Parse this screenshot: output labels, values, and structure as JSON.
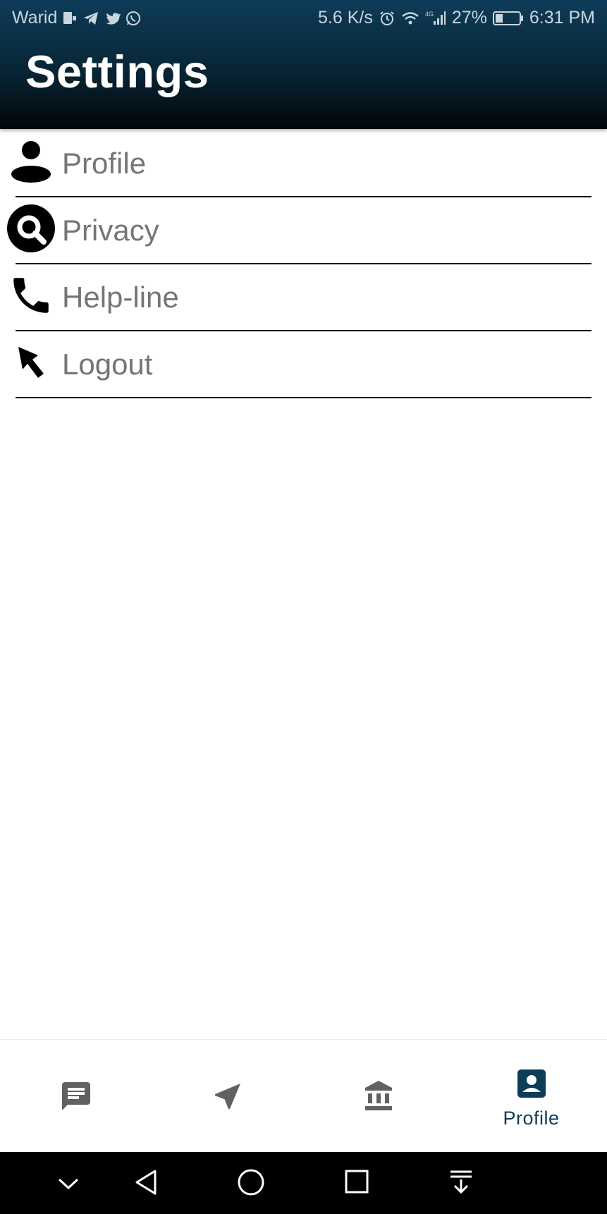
{
  "status_bar": {
    "carrier": "Warid",
    "speed": "5.6 K/s",
    "network": "4G",
    "battery": "27%",
    "time": "6:31 PM"
  },
  "header": {
    "title": "Settings"
  },
  "menu": {
    "items": [
      {
        "label": "Profile",
        "icon": "person-icon"
      },
      {
        "label": "Privacy",
        "icon": "privacy-search-icon"
      },
      {
        "label": "Help-line",
        "icon": "phone-icon"
      },
      {
        "label": "Logout",
        "icon": "arrow-pointer-icon"
      }
    ]
  },
  "bottom_nav": {
    "items": [
      {
        "icon": "message-icon",
        "label": ""
      },
      {
        "icon": "navigation-arrow-icon",
        "label": ""
      },
      {
        "icon": "bank-icon",
        "label": ""
      },
      {
        "icon": "profile-badge-icon",
        "label": "Profile",
        "active": true
      }
    ]
  },
  "colors": {
    "header_top": "#0d3c58",
    "header_bottom": "#020608",
    "accent": "#0c3c58",
    "label_gray": "#757575",
    "nav_icon_gray": "#616161"
  }
}
